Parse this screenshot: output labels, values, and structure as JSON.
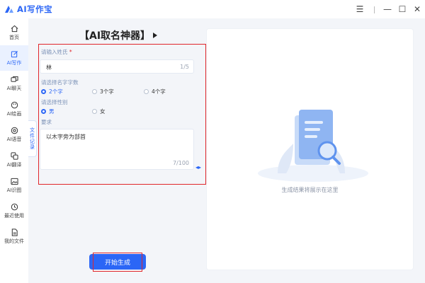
{
  "app": {
    "title": "AI写作宝",
    "brand_color": "#2b66f6",
    "window_controls": {
      "menu": "☰",
      "minimize": "—",
      "maximize": "☐",
      "close": "✕"
    }
  },
  "sidebar": {
    "items": [
      {
        "label": "首页",
        "icon": "home-icon"
      },
      {
        "label": "AI写作",
        "icon": "edit-icon",
        "active": true
      },
      {
        "label": "AI聊天",
        "icon": "chat-icon"
      },
      {
        "label": "AI绘画",
        "icon": "palette-icon"
      },
      {
        "label": "AI语音",
        "icon": "voice-icon"
      },
      {
        "label": "AI翻译",
        "icon": "translate-icon"
      },
      {
        "label": "AI识图",
        "icon": "image-icon"
      },
      {
        "label": "最近使用",
        "icon": "history-icon"
      },
      {
        "label": "我的文件",
        "icon": "file-icon"
      }
    ],
    "record_tab": "文件记录"
  },
  "form": {
    "title": "【AI取名神器】",
    "surname": {
      "label": "请输入姓氏",
      "required_mark": "*",
      "value": "林",
      "counter": "1/5"
    },
    "word_count": {
      "label": "请选择名字字数",
      "options": [
        "2个字",
        "3个字",
        "4个字"
      ],
      "selected": 0
    },
    "gender": {
      "label": "请选择性别",
      "options": [
        "男",
        "女"
      ],
      "selected": 0
    },
    "hint": {
      "label": "要求",
      "value": "以木字旁为部首",
      "counter": "7/100"
    },
    "start_button": "开始生成"
  },
  "result": {
    "empty_text": "生成结果将展示在这里"
  }
}
